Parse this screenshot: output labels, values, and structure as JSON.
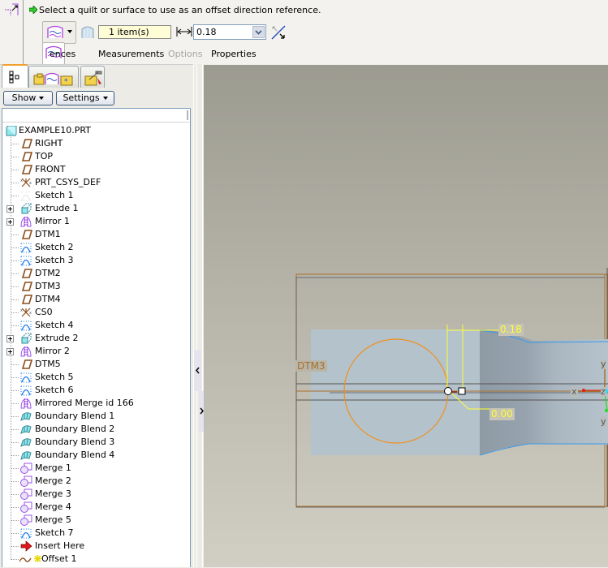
{
  "dashboard": {
    "prompt": "Select a quilt or surface to use as an offset direction reference.",
    "type_selector": {
      "icon": "offset-standard-icon",
      "popup_icon": "offset-standard-icon"
    },
    "reference_collector": {
      "icon": "quilt-icon",
      "value": "1 item(s)"
    },
    "distance": {
      "icon": "distance-arrow-icon",
      "value": "0.18"
    },
    "flip_icon": "flip-direction-icon",
    "tabs": [
      {
        "label": "References",
        "visible_label": "ences",
        "enabled": true
      },
      {
        "label": "Measurements",
        "enabled": true
      },
      {
        "label": "Options",
        "enabled": false
      },
      {
        "label": "Properties",
        "enabled": true
      }
    ]
  },
  "navigator": {
    "tabs": [
      {
        "name": "model-tree",
        "icon": "model-tree-icon",
        "active": true
      },
      {
        "name": "folder-browser",
        "icon": "folder-icon"
      },
      {
        "name": "connections",
        "icon": "folder-tools-icon"
      }
    ],
    "show_label": "Show",
    "settings_label": "Settings",
    "root": {
      "label": "EXAMPLE10.PRT",
      "icon": "part-icon"
    },
    "items": [
      {
        "label": "RIGHT",
        "icon": "datum-plane-icon"
      },
      {
        "label": "TOP",
        "icon": "datum-plane-icon"
      },
      {
        "label": "FRONT",
        "icon": "datum-plane-icon"
      },
      {
        "label": "PRT_CSYS_DEF",
        "icon": "csys-icon"
      },
      {
        "label": "Sketch 1",
        "icon": "sketch-hidden-icon"
      },
      {
        "label": "Extrude 1",
        "icon": "extrude-icon",
        "expandable": true
      },
      {
        "label": "Mirror 1",
        "icon": "mirror-icon",
        "expandable": true
      },
      {
        "label": "DTM1",
        "icon": "datum-plane-icon"
      },
      {
        "label": "Sketch 2",
        "icon": "sketch-icon"
      },
      {
        "label": "Sketch 3",
        "icon": "sketch-icon"
      },
      {
        "label": "DTM2",
        "icon": "datum-plane-icon"
      },
      {
        "label": "DTM3",
        "icon": "datum-plane-icon"
      },
      {
        "label": "DTM4",
        "icon": "datum-plane-icon"
      },
      {
        "label": "CS0",
        "icon": "csys-icon"
      },
      {
        "label": "Sketch 4",
        "icon": "sketch-icon"
      },
      {
        "label": "Extrude 2",
        "icon": "extrude-icon",
        "expandable": true
      },
      {
        "label": "Mirror 2",
        "icon": "mirror-icon",
        "expandable": true
      },
      {
        "label": "DTM5",
        "icon": "datum-plane-icon"
      },
      {
        "label": "Sketch 5",
        "icon": "sketch-icon"
      },
      {
        "label": "Sketch 6",
        "icon": "sketch-icon"
      },
      {
        "label": "Mirrored Merge id 166",
        "icon": "mirror-icon"
      },
      {
        "label": "Boundary Blend 1",
        "icon": "boundary-blend-icon"
      },
      {
        "label": "Boundary Blend 2",
        "icon": "boundary-blend-icon"
      },
      {
        "label": "Boundary Blend 3",
        "icon": "boundary-blend-icon"
      },
      {
        "label": "Boundary Blend 4",
        "icon": "boundary-blend-icon"
      },
      {
        "label": "Merge 1",
        "icon": "merge-icon"
      },
      {
        "label": "Merge 2",
        "icon": "merge-icon"
      },
      {
        "label": "Merge 3",
        "icon": "merge-icon"
      },
      {
        "label": "Merge 4",
        "icon": "merge-icon"
      },
      {
        "label": "Merge 5",
        "icon": "merge-icon"
      },
      {
        "label": "Sketch 7",
        "icon": "sketch-icon"
      },
      {
        "label": "Insert Here",
        "icon": "insert-here-arrow-icon"
      },
      {
        "label": "Offset 1",
        "icon": "offset-curve-icon",
        "new": true
      }
    ]
  },
  "graphics": {
    "datum_label": "DTM3",
    "dimension_offset": "0.18",
    "dimension_zero": "0.00",
    "axis_labels": {
      "x": "x",
      "y_top": "y",
      "z": "z",
      "y_bottom": "y"
    },
    "colors": {
      "background_top": "#9c9b90",
      "background_bottom": "#d1cfc3",
      "surface": "#b4c2cc",
      "datum": "#a96f2c",
      "sketch": "#f0901a",
      "dimension": "#ffff33",
      "edge": "#3a9ae8"
    }
  }
}
